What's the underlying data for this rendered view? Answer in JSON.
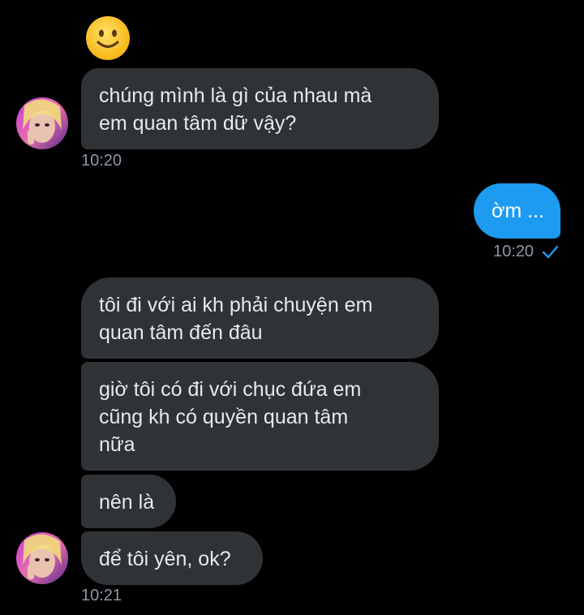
{
  "colors": {
    "background": "#000000",
    "incoming_bubble": "#2f3336",
    "outgoing_bubble": "#1d9bf0",
    "timestamp": "#8b98a5",
    "check": "#1d9bf0"
  },
  "messages": [
    {
      "type": "emoji",
      "icon": "slightly-smiling-face-icon"
    },
    {
      "type": "incoming",
      "lines": [
        "chúng mình là gì của nhau mà",
        "em quan tâm dữ vậy?"
      ],
      "time": "10:20"
    },
    {
      "type": "outgoing",
      "lines": [
        "ờm ..."
      ],
      "time": "10:20",
      "status_icon": "check-icon"
    },
    {
      "type": "incoming",
      "lines": [
        "tôi đi với ai kh phải chuyện em",
        "quan tâm đến đâu"
      ]
    },
    {
      "type": "incoming",
      "lines": [
        "giờ tôi có đi với chục đứa em",
        "cũng kh có quyền quan tâm",
        "nữa"
      ]
    },
    {
      "type": "incoming",
      "lines": [
        "nên là"
      ]
    },
    {
      "type": "incoming",
      "lines": [
        "để tôi yên, ok?"
      ],
      "time": "10:21"
    }
  ]
}
